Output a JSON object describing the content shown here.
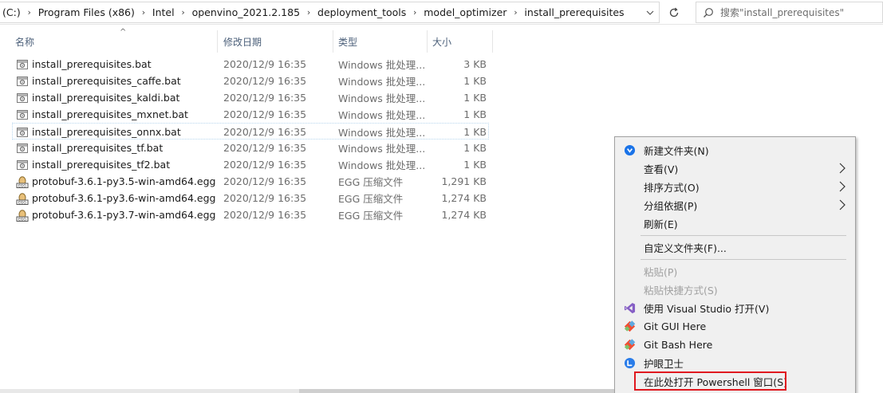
{
  "address_bar": {
    "crumbs": [
      "(C:)",
      "Program Files (x86)",
      "Intel",
      "openvino_2021.2.185",
      "deployment_tools",
      "model_optimizer",
      "install_prerequisites"
    ],
    "search_placeholder": "搜索\"install_prerequisites\""
  },
  "columns": {
    "name": "名称",
    "date": "修改日期",
    "type": "类型",
    "size": "大小"
  },
  "files": [
    {
      "name": "install_prerequisites.bat",
      "date": "2020/12/9 16:35",
      "type": "Windows 批处理...",
      "size": "3 KB",
      "icon": "batch-file-icon"
    },
    {
      "name": "install_prerequisites_caffe.bat",
      "date": "2020/12/9 16:35",
      "type": "Windows 批处理...",
      "size": "1 KB",
      "icon": "batch-file-icon"
    },
    {
      "name": "install_prerequisites_kaldi.bat",
      "date": "2020/12/9 16:35",
      "type": "Windows 批处理...",
      "size": "1 KB",
      "icon": "batch-file-icon"
    },
    {
      "name": "install_prerequisites_mxnet.bat",
      "date": "2020/12/9 16:35",
      "type": "Windows 批处理...",
      "size": "1 KB",
      "icon": "batch-file-icon"
    },
    {
      "name": "install_prerequisites_onnx.bat",
      "date": "2020/12/9 16:35",
      "type": "Windows 批处理...",
      "size": "1 KB",
      "icon": "batch-file-icon"
    },
    {
      "name": "install_prerequisites_tf.bat",
      "date": "2020/12/9 16:35",
      "type": "Windows 批处理...",
      "size": "1 KB",
      "icon": "batch-file-icon"
    },
    {
      "name": "install_prerequisites_tf2.bat",
      "date": "2020/12/9 16:35",
      "type": "Windows 批处理...",
      "size": "1 KB",
      "icon": "batch-file-icon"
    },
    {
      "name": "protobuf-3.6.1-py3.5-win-amd64.egg",
      "date": "2020/12/9 16:35",
      "type": "EGG 压缩文件",
      "size": "1,291 KB",
      "icon": "egg-file-icon"
    },
    {
      "name": "protobuf-3.6.1-py3.6-win-amd64.egg",
      "date": "2020/12/9 16:35",
      "type": "EGG 压缩文件",
      "size": "1,274 KB",
      "icon": "egg-file-icon"
    },
    {
      "name": "protobuf-3.6.1-py3.7-win-amd64.egg",
      "date": "2020/12/9 16:35",
      "type": "EGG 压缩文件",
      "size": "1,274 KB",
      "icon": "egg-file-icon"
    }
  ],
  "context_menu": {
    "new_folder": "新建文件夹(N)",
    "view": "查看(V)",
    "sort_by": "排序方式(O)",
    "group_by": "分组依据(P)",
    "refresh": "刷新(E)",
    "customize_folder": "自定义文件夹(F)...",
    "paste": "粘贴(P)",
    "paste_shortcut": "粘贴快捷方式(S)",
    "open_visual_studio": "使用 Visual Studio 打开(V)",
    "git_gui": "Git GUI Here",
    "git_bash": "Git Bash Here",
    "eye_guard": "护眼卫士",
    "open_powershell": "在此处打开 Powershell 窗口(S)"
  },
  "colors": {
    "highlight_border": "#e0191f",
    "header_text": "#4c607a",
    "menu_background": "#f0f0f0"
  }
}
